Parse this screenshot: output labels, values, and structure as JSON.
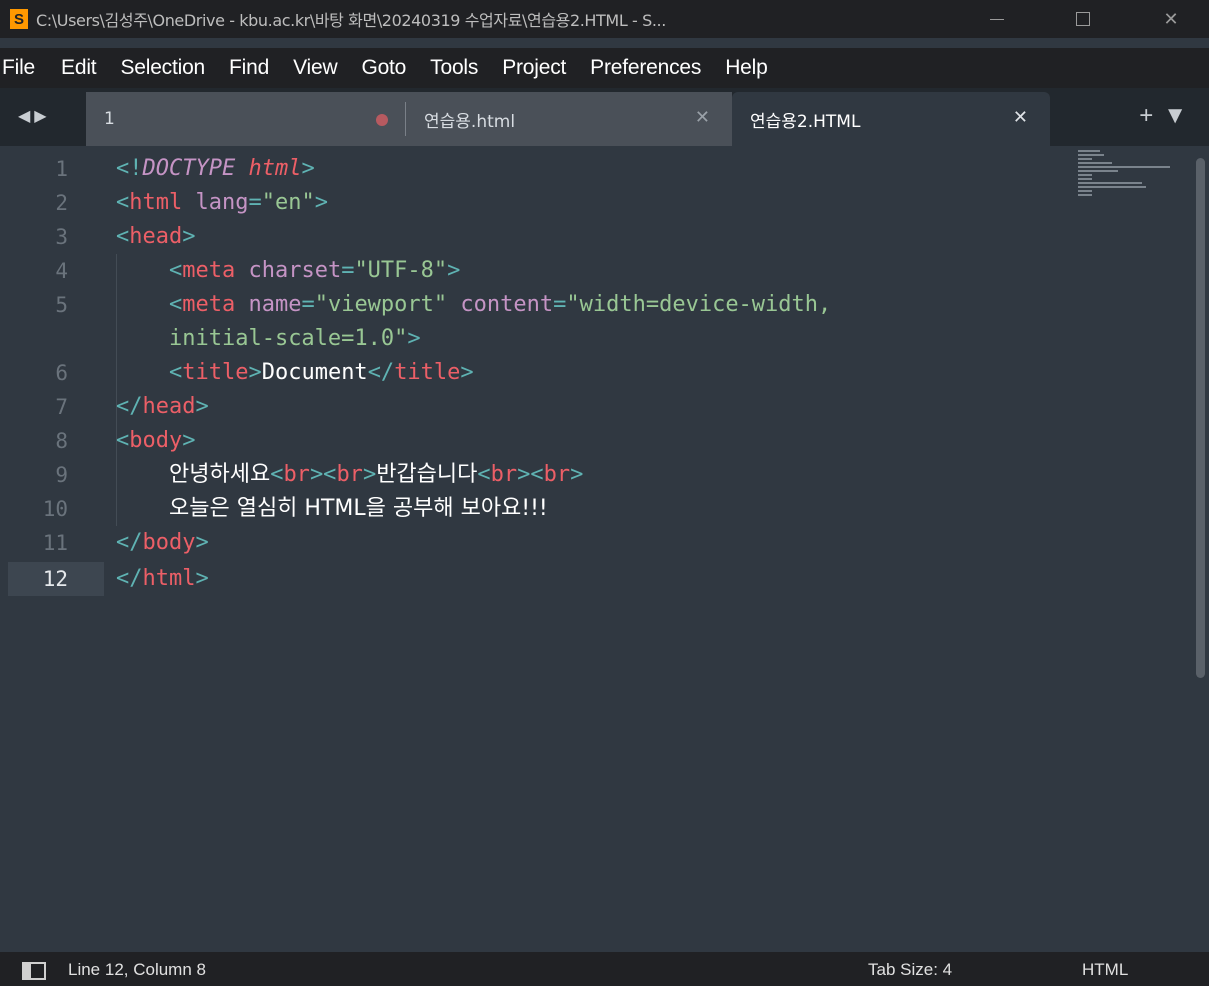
{
  "window": {
    "title": "C:\\Users\\김성주\\OneDrive - kbu.ac.kr\\바탕 화면\\20240319 수업자료\\연습용2.HTML - S...",
    "logo_glyph": "S",
    "minimize_icon": "minimize-icon",
    "maximize_icon": "maximize-icon",
    "close_glyph": "✕"
  },
  "menu": {
    "items": [
      "File",
      "Edit",
      "Selection",
      "Find",
      "View",
      "Goto",
      "Tools",
      "Project",
      "Preferences",
      "Help"
    ]
  },
  "tabs": {
    "nav_glyph": "◀▶",
    "items": [
      {
        "label": "1",
        "dirty": true
      },
      {
        "label": "연습용.html",
        "close_glyph": "✕"
      },
      {
        "label": "연습용2.HTML",
        "close_glyph": "✕",
        "active": true
      }
    ],
    "actions_glyph": "+▼"
  },
  "editor": {
    "line_numbers": [
      "1",
      "2",
      "3",
      "4",
      "5",
      "",
      "6",
      "7",
      "8",
      "9",
      "10",
      "11",
      "12"
    ],
    "active_line": "12",
    "code": {
      "l1_open": "<!",
      "l1_doctype": "DOCTYPE",
      "l1_html": "html",
      "l1_close": ">",
      "l2_tag": "html",
      "l2_attr": "lang",
      "l2_val": "\"en\"",
      "l3_tag": "head",
      "l4_tag": "meta",
      "l4_attr": "charset",
      "l4_val": "\"UTF-8\"",
      "l5_tag": "meta",
      "l5_attr1": "name",
      "l5_val1": "\"viewport\"",
      "l5_attr2": "content",
      "l5_val2a": "\"width=device-width,",
      "l5_val2b": "initial-scale=1.0\"",
      "l6_tag": "title",
      "l6_text": "Document",
      "l7_tag": "head",
      "l8_tag": "body",
      "l9_text1": "안녕하세요",
      "l9_br": "br",
      "l9_text2": "반갑습니다",
      "l10_text": "오늘은 열심히 HTML을 공부해 보아요!!!",
      "l11_tag": "body",
      "l12_tag": "html"
    }
  },
  "status": {
    "position": "Line 12, Column 8",
    "tab_size": "Tab Size: 4",
    "syntax": "HTML"
  },
  "colors": {
    "editor_bg": "#303841",
    "tag": "#ec5f67",
    "punctuation": "#5fb3b3",
    "attribute": "#c594c5",
    "string": "#99c794",
    "chrome": "#202124"
  }
}
